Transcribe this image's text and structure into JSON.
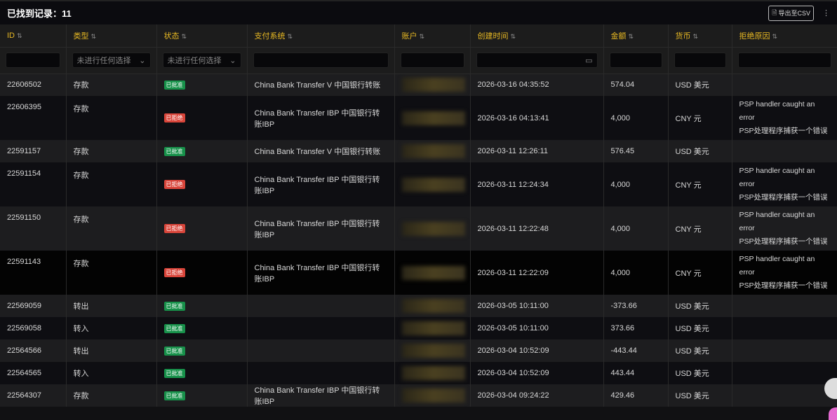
{
  "header": {
    "title": "已找到记录：11",
    "export_label": "导出至CSV",
    "menu": "⋮"
  },
  "columns": [
    "ID",
    "类型",
    "状态",
    "支付系统",
    "账户",
    "创建时间",
    "金额",
    "货币",
    "拒绝原因"
  ],
  "filters": {
    "type_placeholder": "未进行任何选择",
    "status_placeholder": "未进行任何选择"
  },
  "rows": [
    {
      "id": "22606502",
      "type": "存款",
      "status": "已批准",
      "ok": true,
      "system": "China Bank Transfer V 中国银行转账",
      "time": "2026-03-16 04:35:52",
      "amount": "574.04",
      "currency": "USD 美元",
      "reason": []
    },
    {
      "id": "22606395",
      "type": "存款",
      "status": "已拒绝",
      "ok": false,
      "system": "China Bank Transfer IBP 中国银行转账IBP",
      "time": "2026-03-16 04:13:41",
      "amount": "4,000",
      "currency": "CNY 元",
      "reason": [
        "PSP handler caught an error",
        "PSP处理程序捕获一个错误"
      ]
    },
    {
      "id": "22591157",
      "type": "存款",
      "status": "已批准",
      "ok": true,
      "system": "China Bank Transfer V 中国银行转账",
      "time": "2026-03-11 12:26:11",
      "amount": "576.45",
      "currency": "USD 美元",
      "reason": []
    },
    {
      "id": "22591154",
      "type": "存款",
      "status": "已拒绝",
      "ok": false,
      "system": "China Bank Transfer IBP 中国银行转账IBP",
      "time": "2026-03-11 12:24:34",
      "amount": "4,000",
      "currency": "CNY 元",
      "reason": [
        "PSP handler caught an error",
        "PSP处理程序捕获一个错误"
      ]
    },
    {
      "id": "22591150",
      "type": "存款",
      "status": "已拒绝",
      "ok": false,
      "system": "China Bank Transfer IBP 中国银行转账IBP",
      "time": "2026-03-11 12:22:48",
      "amount": "4,000",
      "currency": "CNY 元",
      "reason": [
        "PSP handler caught an error",
        "PSP处理程序捕获一个错误"
      ]
    },
    {
      "id": "22591143",
      "type": "存款",
      "status": "已拒绝",
      "ok": false,
      "system": "China Bank Transfer IBP 中国银行转账IBP",
      "time": "2026-03-11 12:22:09",
      "amount": "4,000",
      "currency": "CNY 元",
      "reason": [
        "PSP handler caught an error",
        "PSP处理程序捕获一个错误"
      ]
    },
    {
      "id": "22569059",
      "type": "转出",
      "status": "已批准",
      "ok": true,
      "system": "",
      "time": "2026-03-05 10:11:00",
      "amount": "-373.66",
      "currency": "USD 美元",
      "reason": []
    },
    {
      "id": "22569058",
      "type": "转入",
      "status": "已批准",
      "ok": true,
      "system": "",
      "time": "2026-03-05 10:11:00",
      "amount": "373.66",
      "currency": "USD 美元",
      "reason": []
    },
    {
      "id": "22564566",
      "type": "转出",
      "status": "已批准",
      "ok": true,
      "system": "",
      "time": "2026-03-04 10:52:09",
      "amount": "-443.44",
      "currency": "USD 美元",
      "reason": []
    },
    {
      "id": "22564565",
      "type": "转入",
      "status": "已批准",
      "ok": true,
      "system": "",
      "time": "2026-03-04 10:52:09",
      "amount": "443.44",
      "currency": "USD 美元",
      "reason": []
    },
    {
      "id": "22564307",
      "type": "存款",
      "status": "已批准",
      "ok": true,
      "system": "China Bank Transfer IBP 中国银行转账IBP",
      "time": "2026-03-04 09:24:22",
      "amount": "429.46",
      "currency": "USD 美元",
      "reason": []
    }
  ]
}
